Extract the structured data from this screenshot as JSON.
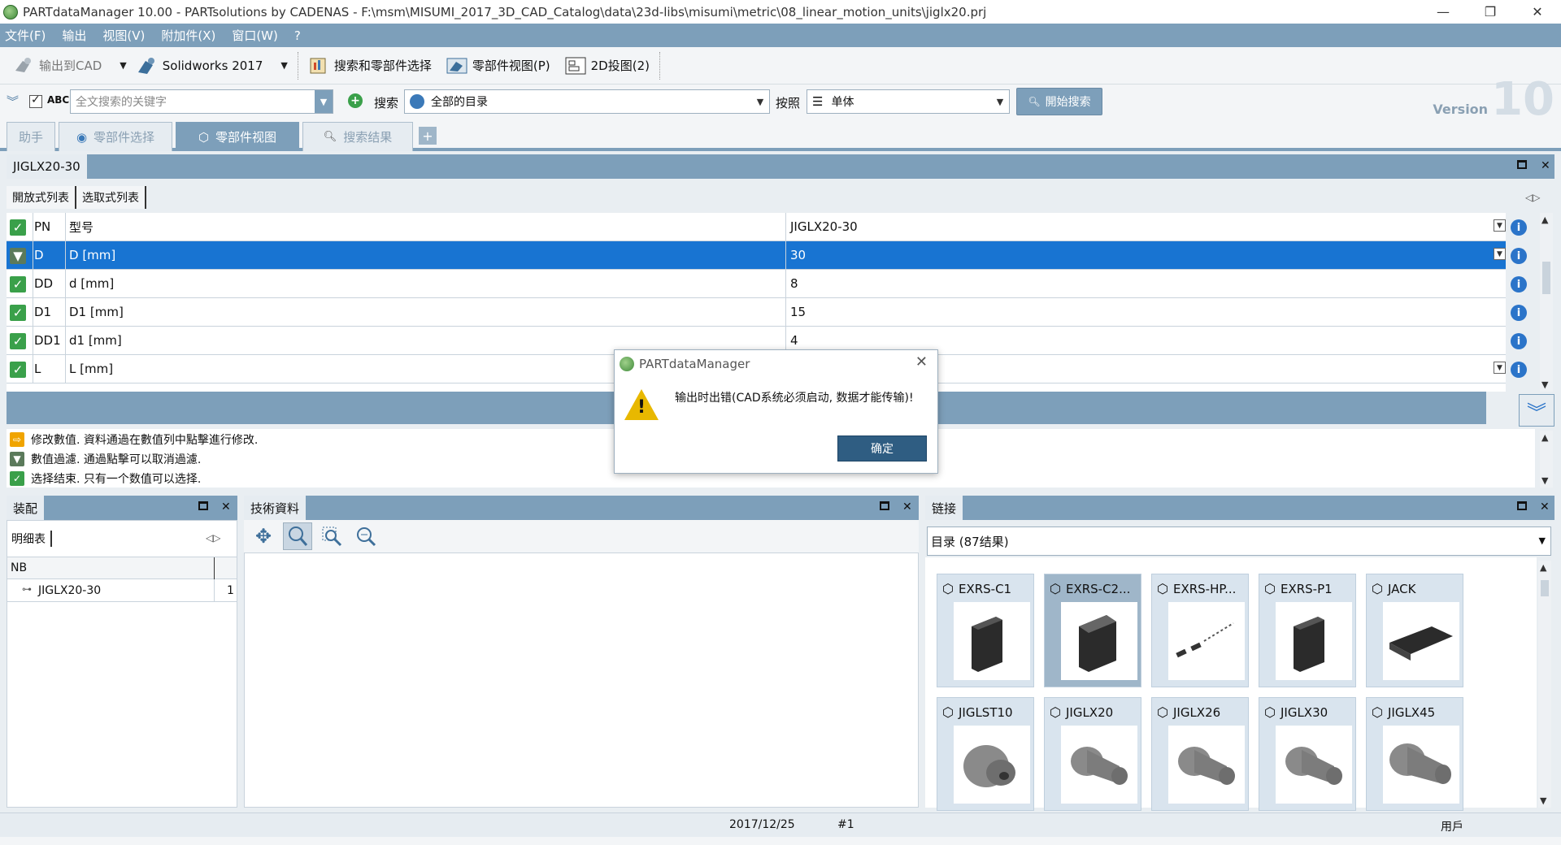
{
  "window": {
    "title": "PARTdataManager 10.00 - PARTsolutions by CADENAS - F:\\msm\\MISUMI_2017_3D_CAD_Catalog\\data\\23d-libs\\misumi\\metric\\08_linear_motion_units\\jiglx20.prj",
    "min_glyph": "—",
    "restore_glyph": "❐",
    "close_glyph": "✕"
  },
  "menu": [
    "文件(F)",
    "输出",
    "视图(V)",
    "附加件(X)",
    "窗口(W)",
    "?"
  ],
  "toolbar": {
    "export_cad": "输出到CAD",
    "cad_system": "Solidworks 2017",
    "search_select": "搜索和零部件选择",
    "part_view": "零部件视图(P)",
    "drawing_2d": "2D投图(2)"
  },
  "search": {
    "abc": "ABC",
    "keyword_placeholder": "全文搜索的关键字",
    "search_label": "搜索",
    "catalog": "全部的目录",
    "by_label": "按照",
    "mode": "单体",
    "start_button": "開始搜索"
  },
  "version": {
    "label": "Version",
    "number": "10"
  },
  "tabs": [
    {
      "label": "助手",
      "icon": ""
    },
    {
      "label": "零部件选择",
      "icon": "catalog-icon"
    },
    {
      "label": "零部件视图",
      "icon": "part-view-icon"
    },
    {
      "label": "搜索结果",
      "icon": "search-icon"
    }
  ],
  "tab_add": "+",
  "part_panel": {
    "title": "JIGLX20-30",
    "subtabs": [
      "開放式列表",
      "选取式列表"
    ],
    "rows": [
      {
        "pn": "PN",
        "name": "型号",
        "value": "JIGLX20-30",
        "dropdown": true
      },
      {
        "pn": "D",
        "name": "D [mm]",
        "value": "30",
        "dropdown": true,
        "selected": true
      },
      {
        "pn": "DD",
        "name": "d [mm]",
        "value": "8"
      },
      {
        "pn": "D1",
        "name": "D1 [mm]",
        "value": "15"
      },
      {
        "pn": "DD1",
        "name": "d1 [mm]",
        "value": "4"
      },
      {
        "pn": "L",
        "name": "L [mm]",
        "value": "",
        "dropdown": true
      }
    ],
    "messages": [
      {
        "text": "修改數值. 資料通過在數值列中點擊進行修改.",
        "color": "#f0a400",
        "glyph": "⇨"
      },
      {
        "text": "數值過濾. 通過點擊可以取消過濾.",
        "color": "#5b7a5b",
        "glyph": "▼"
      },
      {
        "text": "选择结束. 只有一个数值可以选择.",
        "color": "#3aa04a",
        "glyph": "✓"
      }
    ]
  },
  "assembly": {
    "title": "装配",
    "subtab": "明细表",
    "column": "NB",
    "item_name": "JIGLX20-30",
    "item_qty": "1"
  },
  "tech": {
    "title": "技術資料"
  },
  "links": {
    "title": "链接",
    "dropdown": "目录 (87结果)",
    "items": [
      {
        "label": "EXRS-C1",
        "selected": false
      },
      {
        "label": "EXRS-C2...",
        "selected": true
      },
      {
        "label": "EXRS-HP...",
        "selected": false
      },
      {
        "label": "EXRS-P1",
        "selected": false
      },
      {
        "label": "JACK",
        "selected": false
      },
      {
        "label": "JIGLST10",
        "selected": false
      },
      {
        "label": "JIGLX20",
        "selected": false
      },
      {
        "label": "JIGLX26",
        "selected": false
      },
      {
        "label": "JIGLX30",
        "selected": false
      },
      {
        "label": "JIGLX45",
        "selected": false
      }
    ]
  },
  "status": {
    "date": "2017/12/25",
    "number": "#1",
    "user": "用戶"
  },
  "dialog": {
    "title": "PARTdataManager",
    "message": "输出时出错(CAD系统必须启动, 数据才能传输)!",
    "ok": "确定"
  }
}
